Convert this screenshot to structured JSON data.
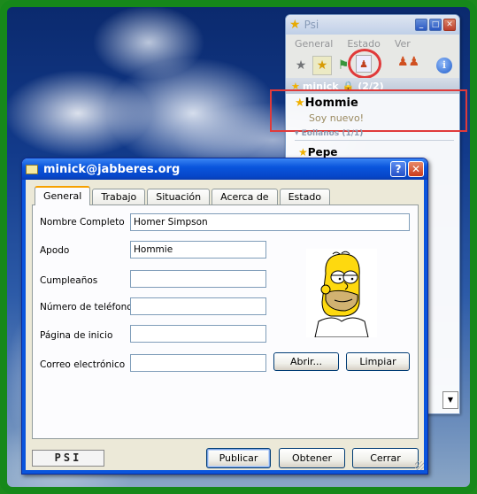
{
  "psi": {
    "title": "Psi",
    "menu": [
      "General",
      "Estado",
      "Ver"
    ],
    "group": {
      "name": "minick",
      "count": "(2/2)"
    },
    "contact": {
      "name": "Hommie",
      "status": "Soy nuevo!"
    },
    "group2": {
      "name": "Eollanos",
      "count": "(1/1)"
    },
    "contact2": {
      "name": "Pepe"
    }
  },
  "dialog": {
    "title": "minick@jabberes.org",
    "tabs": [
      "General",
      "Trabajo",
      "Situación",
      "Acerca de",
      "Estado"
    ],
    "fields": {
      "full_name": {
        "label": "Nombre Completo",
        "value": "Homer Simpson"
      },
      "nickname": {
        "label": "Apodo",
        "value": "Hommie"
      },
      "birthday": {
        "label": "Cumpleaños",
        "value": ""
      },
      "phone": {
        "label": "Número de teléfono",
        "value": ""
      },
      "homepage": {
        "label": "Página de inicio",
        "value": ""
      },
      "email": {
        "label": "Correo electrónico",
        "value": ""
      }
    },
    "buttons": {
      "open": "Abrir...",
      "clear": "Limpiar",
      "publish": "Publicar",
      "get": "Obtener",
      "close": "Cerrar"
    },
    "logo": "PSI",
    "help": "?",
    "close_x": "✕"
  }
}
